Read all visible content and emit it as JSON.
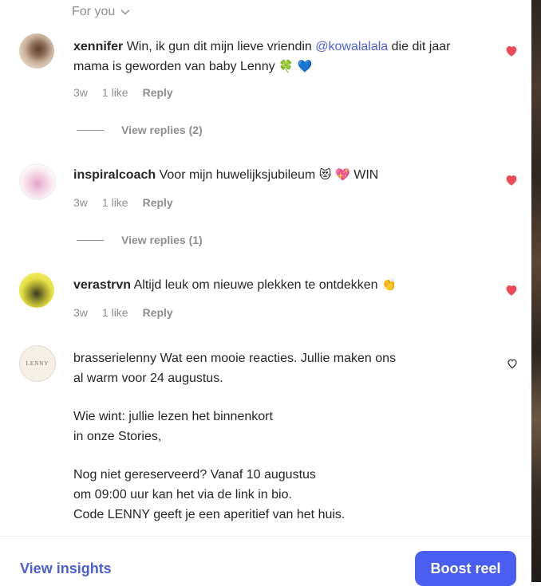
{
  "filter": {
    "label": "For you",
    "icon": "chevron-down-icon"
  },
  "comments": [
    {
      "username": "xennifer",
      "text_before": "Win, ik gun dit mijn lieve vriendin ",
      "mention": "@kowalalala",
      "text_after": " die dit jaar mama is geworden van baby Lenny ",
      "emoji": "🍀 💙",
      "time": "3w",
      "likes": "1 like",
      "reply": "Reply",
      "view_replies": "View replies (2)",
      "liked": true
    },
    {
      "username": "inspiralcoach",
      "text": "Voor mijn huwelijksjubileum ",
      "emoji": "😻 💖",
      "text_after": " WIN",
      "time": "3w",
      "likes": "1 like",
      "reply": "Reply",
      "view_replies": "View replies (1)",
      "liked": true
    },
    {
      "username": "verastrvn",
      "text": "Altijd leuk om nieuwe plekken te ontdekken ",
      "emoji": "👏",
      "time": "3w",
      "likes": "1 like",
      "reply": "Reply",
      "liked": true
    },
    {
      "username": "brasserielenny",
      "avatar_text": "LENNY",
      "line1": "Wat een mooie reacties. Jullie maken ons",
      "line2": "al warm voor 24 augustus.",
      "line3": "Wie wint: jullie lezen het binnenkort",
      "line4": "in onze Stories,",
      "line5": "Nog niet gereserveerd? Vanaf 10 augustus",
      "line6": "om 09:00 uur kan het via de link in bio.",
      "line7": "Code LENNY geeft je een aperitief van het huis.",
      "liked": false
    }
  ],
  "footer": {
    "insights_label": "View insights",
    "boost_label": "Boost reel"
  },
  "colors": {
    "heart_filled": "#ed4956",
    "link": "#4c5fd5",
    "boost_button": "#4a5ff2",
    "muted_text": "#8e8e8e"
  }
}
